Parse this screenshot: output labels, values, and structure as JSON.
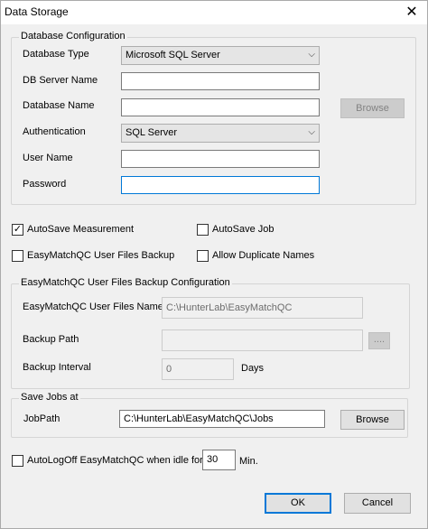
{
  "window": {
    "title": "Data Storage",
    "close_glyph": "✕"
  },
  "database": {
    "legend": "Database Configuration",
    "db_type_label": "Database Type",
    "db_type_value": "Microsoft SQL Server",
    "server_label": "DB Server Name",
    "server_value": "",
    "name_label": "Database Name",
    "name_value": "",
    "browse_label": "Browse",
    "auth_label": "Authentication",
    "auth_value": "SQL Server",
    "user_label": "User Name",
    "user_value": "",
    "password_label": "Password",
    "password_value": ""
  },
  "options": {
    "autosave_measurement": {
      "label": "AutoSave Measurement",
      "checked": true
    },
    "autosave_job": {
      "label": "AutoSave Job",
      "checked": false
    },
    "files_backup": {
      "label": "EasyMatchQC User Files Backup",
      "checked": false
    },
    "allow_duplicates": {
      "label": "Allow Duplicate Names",
      "checked": false
    }
  },
  "backup": {
    "legend": "EasyMatchQC User Files Backup Configuration",
    "files_name_label": "EasyMatchQC User Files Name",
    "files_name_value": "C:\\HunterLab\\EasyMatchQC",
    "path_label": "Backup Path",
    "path_value": "",
    "path_browse_label": "....",
    "interval_label": "Backup Interval",
    "interval_value": "0",
    "interval_unit": "Days"
  },
  "savejobs": {
    "legend": "Save Jobs at",
    "path_label": "JobPath",
    "path_value": "C:\\HunterLab\\EasyMatchQC\\Jobs",
    "browse_label": "Browse"
  },
  "autologoff": {
    "label": "AutoLogOff EasyMatchQC when idle for",
    "checked": false,
    "value": "30",
    "unit": "Min."
  },
  "buttons": {
    "ok_label": "OK",
    "cancel_label": "Cancel"
  }
}
